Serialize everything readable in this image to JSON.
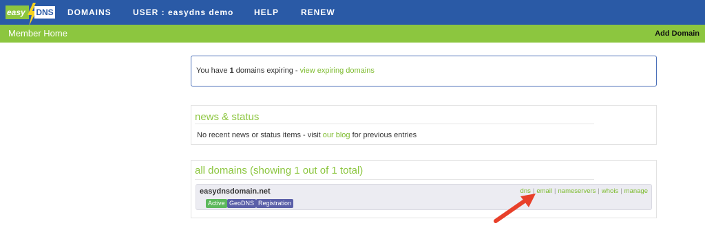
{
  "logo": {
    "part1": "easy",
    "part2": "DNS"
  },
  "nav": {
    "domains": "DOMAINS",
    "user": "USER : easydns demo",
    "help": "HELP",
    "renew": "RENEW"
  },
  "subnav": {
    "home": "Member Home",
    "add_domain": "Add Domain"
  },
  "expiring": {
    "prefix": "You have ",
    "count": "1",
    "middle": " domains expiring - ",
    "link": "view expiring domains"
  },
  "news": {
    "title": "news & status",
    "text_before": "No recent news or status items - visit ",
    "link": "our blog",
    "text_after": " for previous entries"
  },
  "all_domains": {
    "title": "all domains (showing 1 out of 1 total)",
    "domain": {
      "name": "easydnsdomain.net",
      "badges": [
        {
          "label": "Active",
          "color": "#5cb85c"
        },
        {
          "label": "GeoDNS",
          "color": "#5a5fa8"
        },
        {
          "label": "Registration",
          "color": "#5a5fa8"
        }
      ],
      "links": [
        "dns",
        "email",
        "nameservers",
        "whois",
        "manage"
      ],
      "separator": "|"
    }
  },
  "colors": {
    "topbar": "#2a5aa6",
    "subbar": "#8cc63f",
    "accent_green": "#7dbb2e",
    "arrow": "#e8402a"
  }
}
